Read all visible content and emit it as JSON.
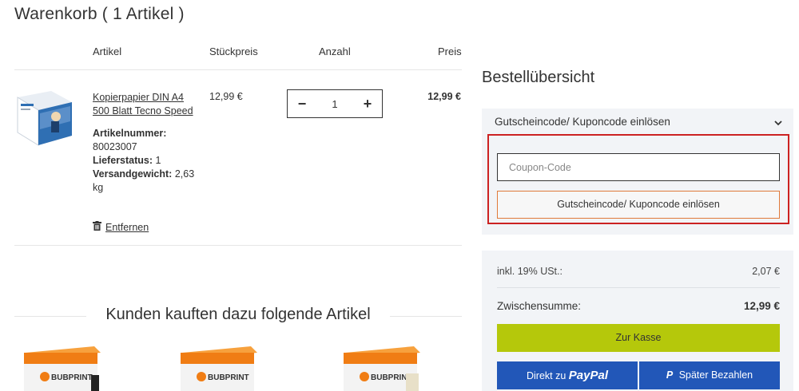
{
  "cart": {
    "title": "Warenkorb ( 1 Artikel )",
    "headers": {
      "artikel": "Artikel",
      "stueckpreis": "Stückpreis",
      "anzahl": "Anzahl",
      "preis": "Preis"
    },
    "item": {
      "name": "Kopierpapier DIN A4 500 Blatt Tecno Speed",
      "artikelnummer_label": "Artikelnummer:",
      "artikelnummer": "80023007",
      "lieferstatus_label": "Lieferstatus:",
      "lieferstatus": "1",
      "versandgewicht_label": "Versandgewicht:",
      "versandgewicht": "2,63 kg",
      "unit_price": "12,99 €",
      "quantity": "1",
      "total_price": "12,99 €",
      "remove_label": "Entfernen"
    }
  },
  "recommendations": {
    "title": "Kunden kauften dazu folgende Artikel",
    "items": [
      {
        "brand": "BUBPRINT"
      },
      {
        "brand": "BUBPRINT"
      },
      {
        "brand": "BUBPRINT"
      }
    ]
  },
  "summary": {
    "title": "Bestellübersicht",
    "coupon": {
      "heading": "Gutscheincode/ Kuponcode einlösen",
      "placeholder": "Coupon-Code",
      "button_label": "Gutscheincode/ Kuponcode einlösen"
    },
    "tax_label": "inkl. 19% USt.:",
    "tax_value": "2,07 €",
    "subtotal_label": "Zwischensumme:",
    "subtotal_value": "12,99 €",
    "checkout_label": "Zur Kasse",
    "paypal_prefix": "Direkt zu",
    "paypal_brand": "PayPal",
    "paylater_label": "Später Bezahlen"
  },
  "colors": {
    "highlight": "#cc2222",
    "checkout": "#b5c80b",
    "paypal": "#2257b8",
    "panel": "#f2f4f7",
    "accent_orange": "#e07a3a"
  }
}
